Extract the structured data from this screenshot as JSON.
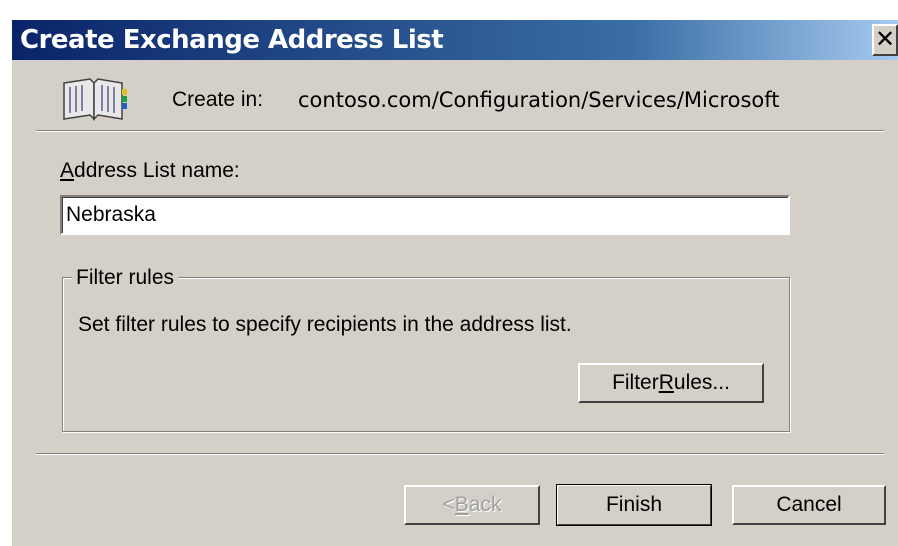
{
  "window": {
    "title": "Create Exchange Address List",
    "close_glyph": "✕"
  },
  "header": {
    "icon": "address-book-icon",
    "create_in_label": "Create in:",
    "create_in_value": "contoso.com/Configuration/Services/Microsoft"
  },
  "form": {
    "name_label_access": "A",
    "name_label_rest": "ddress List name:",
    "name_value": "Nebraska"
  },
  "filter_group": {
    "legend": "Filter rules",
    "description": "Set filter rules to specify recipients in the address list.",
    "button_pre": "Filter ",
    "button_access": "R",
    "button_post": "ules..."
  },
  "buttons": {
    "back_pre": "< ",
    "back_access": "B",
    "back_post": "ack",
    "finish": "Finish",
    "cancel": "Cancel"
  },
  "colors": {
    "dialog_bg": "#d4d0c8",
    "titlebar": "#0a246a",
    "disabled_text": "#a0a0a0"
  }
}
